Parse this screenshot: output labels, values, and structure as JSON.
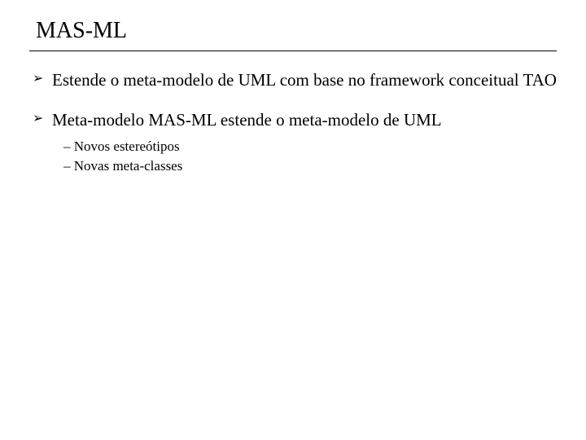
{
  "slide": {
    "title": "MAS-ML",
    "bullets": [
      {
        "text": "Estende o meta-modelo de UML com base no framework conceitual TAO",
        "sub": []
      },
      {
        "text": "Meta-modelo MAS-ML estende o meta-modelo de UML",
        "sub": [
          "Novos estereótipos",
          "Novas meta-classes"
        ]
      }
    ]
  }
}
